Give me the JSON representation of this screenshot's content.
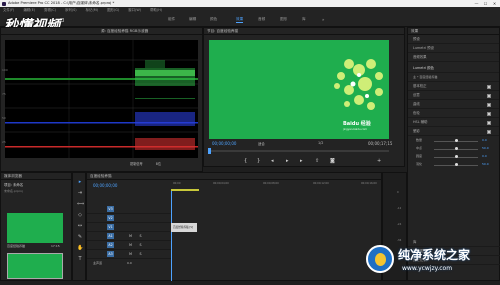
{
  "app": {
    "title": "Adobe Premiere Pro CC 2018 - C:\\用户\\自媒体\\未命名.prproj *",
    "window_buttons": [
      "—",
      "☐",
      "✕"
    ]
  },
  "menu": [
    "文件(F)",
    "编辑(E)",
    "剪辑(C)",
    "序列(S)",
    "标记(M)",
    "图形(G)",
    "窗口(W)",
    "帮助(H)"
  ],
  "workspaces": {
    "tabs": [
      "组件",
      "编辑",
      "颜色",
      "效果",
      "音频",
      "图形",
      "库"
    ],
    "active_index": 3
  },
  "scopes": {
    "title": "Lumetri 范围: 百度经验养猫",
    "tab2": "源: 百度经验养猫 RGB示波器",
    "labels": [
      "100",
      "75",
      "50",
      "25",
      "0"
    ],
    "footer": "8位",
    "footer2": "钳制信号",
    "footer3": "YC"
  },
  "program": {
    "title": "节目: 百度经验养猫",
    "timecode_left": "00;00;00;00",
    "timecode_right": "00;00;17;15",
    "fit": "适合",
    "ratio": "1/2",
    "watermark_brand": "Baidu 经验",
    "watermark_sub": "jingyan.baidu.com"
  },
  "effects": {
    "title": "效果",
    "presets": "预设",
    "lumetri_presets": "Lumetri 预设",
    "audio_effects": "音频效果",
    "panel": "Lumetri 颜色",
    "master": "主 * 百度经验养猫",
    "clip": "百度经验养猫 * 百度经验养猫",
    "sections": [
      "基本校正",
      "创意",
      "曲线",
      "色轮",
      "HSL 辅助",
      "晕影"
    ],
    "sliders": [
      {
        "label": "数量",
        "value": "0.0",
        "pos": 0.5
      },
      {
        "label": "中点",
        "value": "50.0",
        "pos": 0.5
      },
      {
        "label": "圆度",
        "value": "0.0",
        "pos": 0.5
      },
      {
        "label": "羽化",
        "value": "50.0",
        "pos": 0.5
      }
    ],
    "bottom_items": [
      "库",
      "基本图形",
      "历史记录"
    ]
  },
  "project": {
    "title": "媒体浏览器",
    "name": "项目: 未命名",
    "file": "未命名.prproj",
    "items": [
      {
        "name": "百度经验养猫",
        "duration": "17:15"
      },
      {
        "name": "百度经验养猫",
        "duration": "17:15"
      }
    ]
  },
  "timeline": {
    "title": "百度经验养猫",
    "timecode": "00;00;00;00",
    "ruler": [
      "00;00",
      "00;00;04;00",
      "00;00;08;00",
      "00;00;12;00",
      "00;00;16;00"
    ],
    "video_tracks": [
      "V3",
      "V2",
      "V1"
    ],
    "audio_tracks": [
      "A1",
      "A2",
      "A3"
    ],
    "master": "主声道",
    "master_value": "0.0",
    "clip_label": "百度经验养猫 [V]"
  },
  "meter": {
    "labels": [
      "0",
      "-12",
      "-24",
      "-36",
      "-48",
      "dB"
    ]
  },
  "watermark": {
    "brand": "纯净系统之家",
    "url": "www.ycwjzy.com",
    "logo_text": "秒懂视频"
  }
}
